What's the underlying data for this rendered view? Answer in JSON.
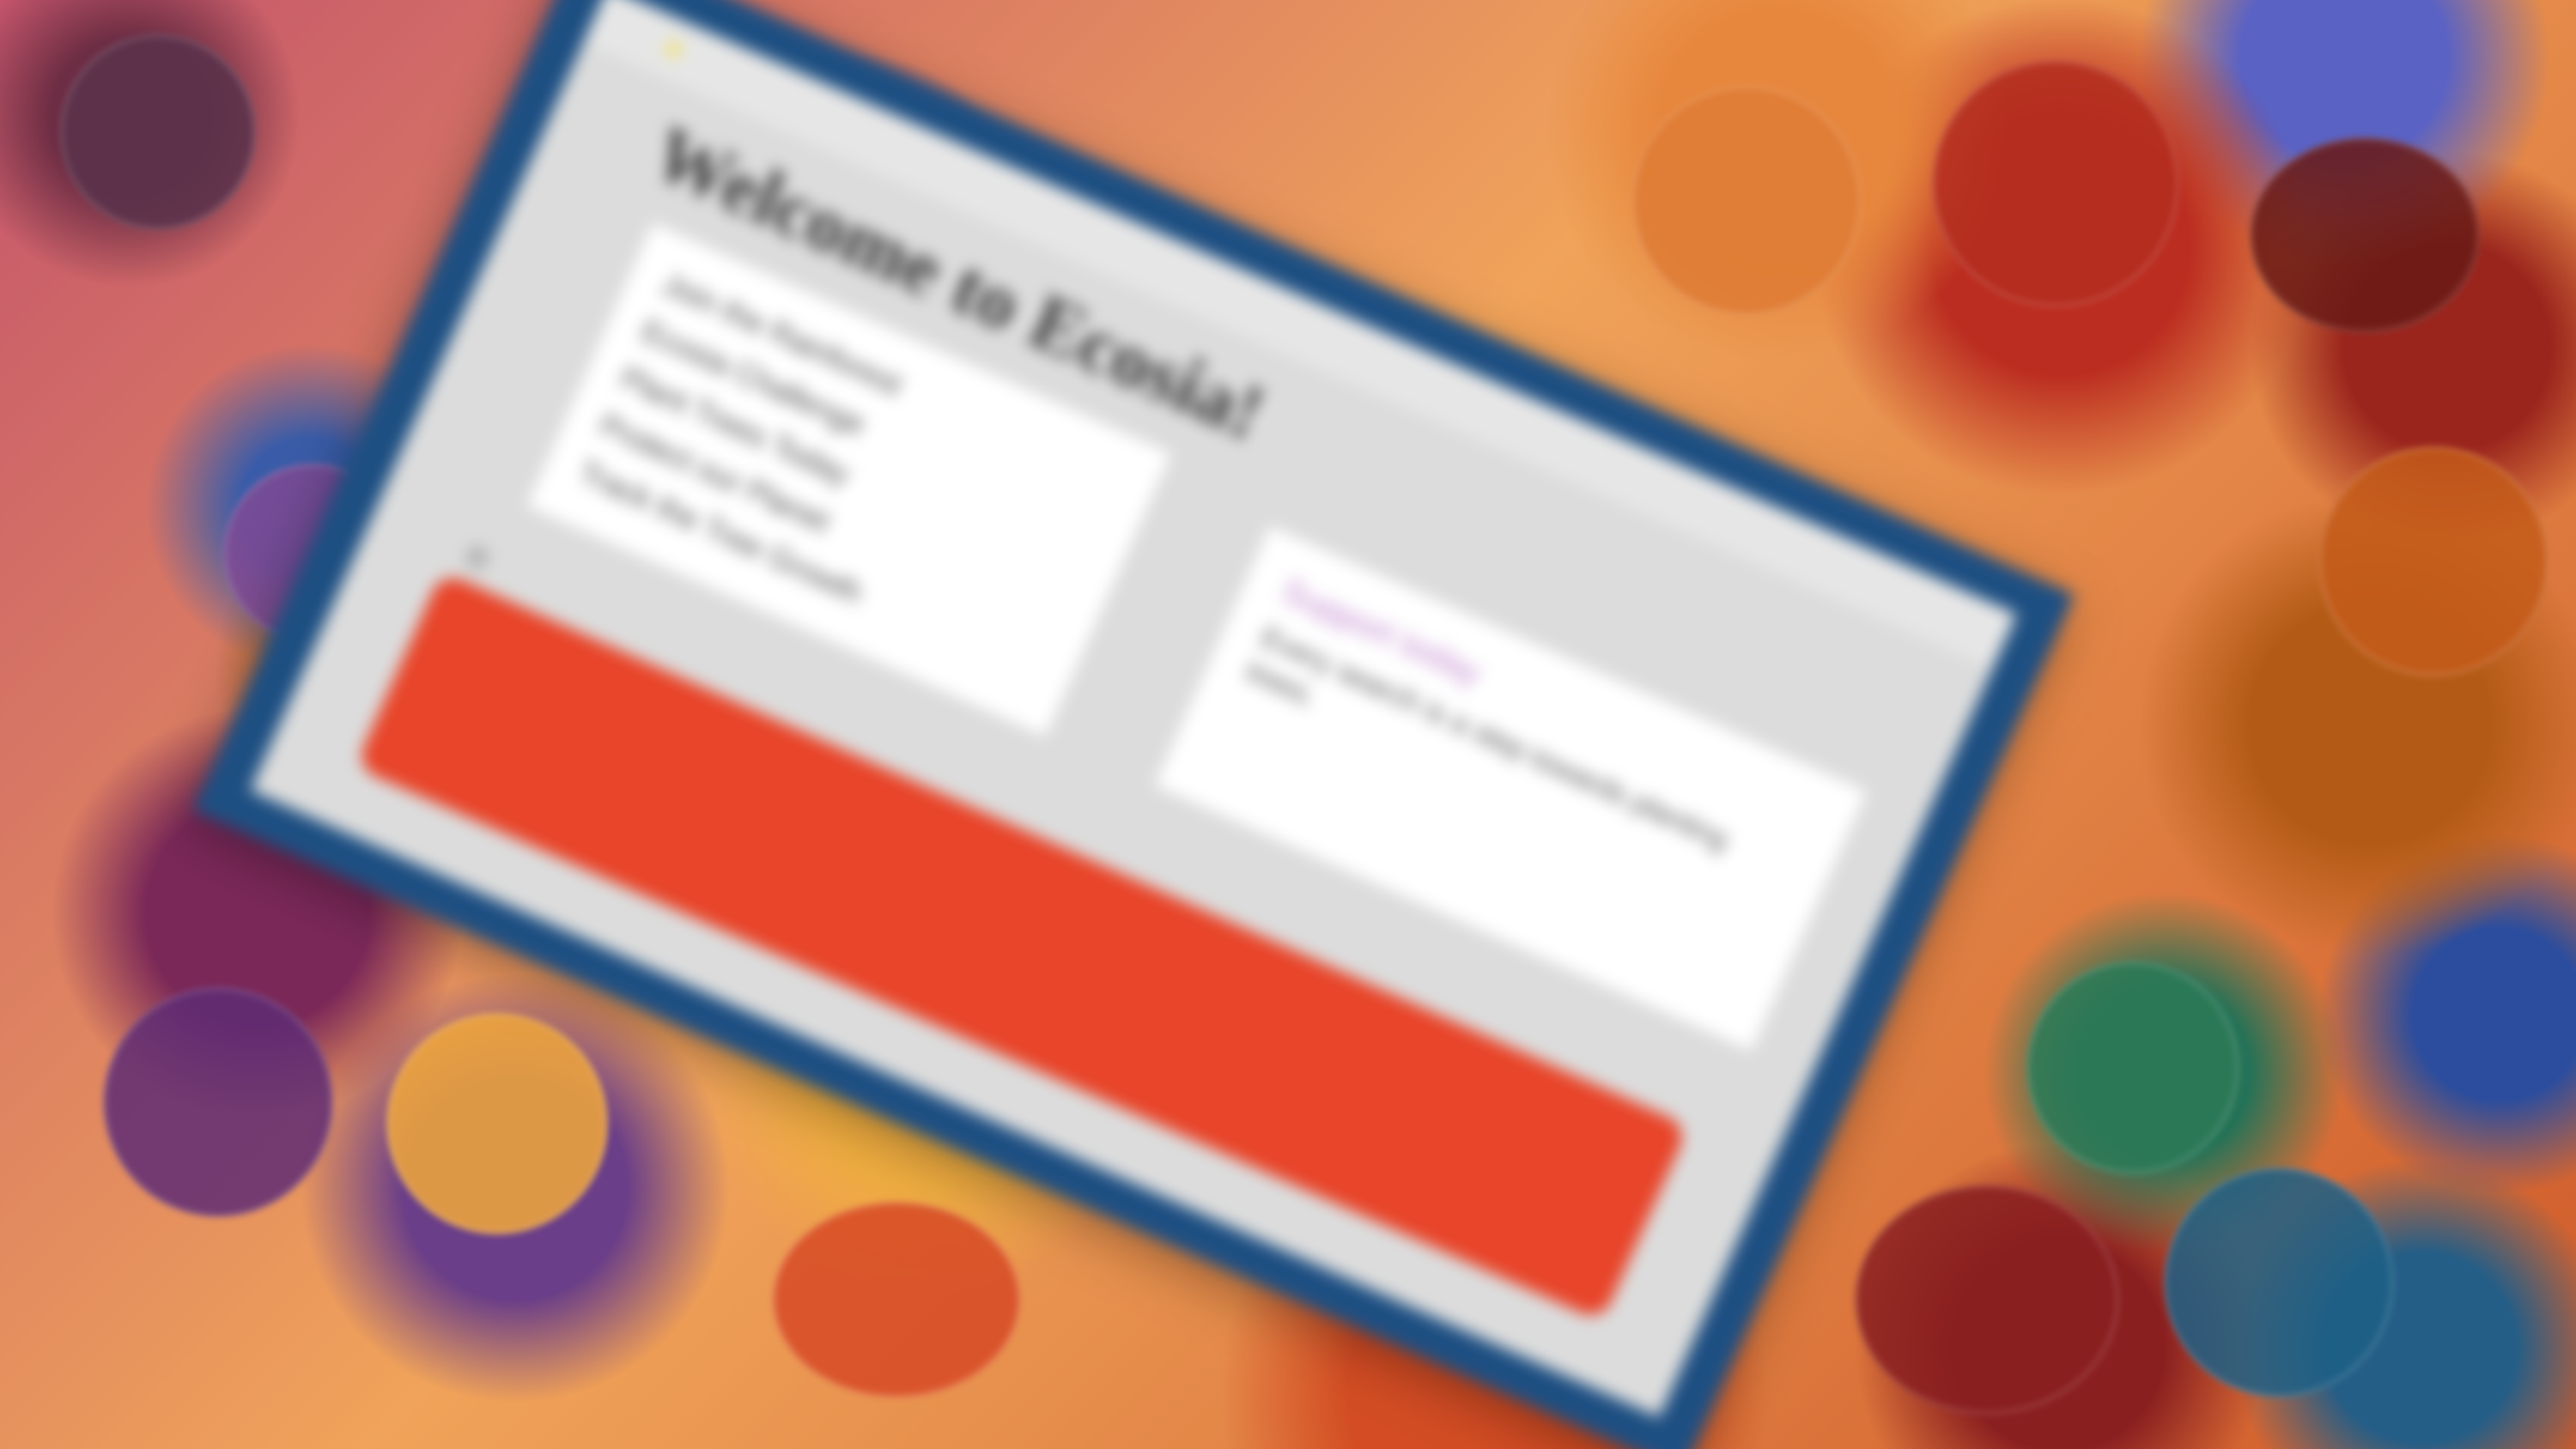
{
  "background": {
    "description_label": "",
    "accent_colors": [
      "#6d2d44",
      "#3a5ca8",
      "#7a2858",
      "#6a3e88",
      "#1f3f8c",
      "#553070",
      "#a76a2a",
      "#f0ad40",
      "#d34c23",
      "#e7873d",
      "#bb2d20",
      "#5a62c4",
      "#9a251d",
      "#b35b16",
      "#247257",
      "#2c4d9d",
      "#8a1f20",
      "#245e87"
    ]
  },
  "window": {
    "title": "Welcome to Ecosia!",
    "frame_color": "#1e4f82",
    "body_color": "#dcdcdc"
  },
  "cards": {
    "left": {
      "lines": [
        "Join the Rainforest",
        "Ecosia Challenge",
        "Plant Trees Today",
        "Protect our Planet",
        "Track the Tree Growth"
      ]
    },
    "right": {
      "heading": "Support today",
      "description": "Every search is a step towards planting trees."
    }
  },
  "banner": {
    "label": "",
    "color": "#e8452a"
  },
  "icons": {
    "settings": "gear-icon"
  },
  "corner_text_top": "",
  "corner_text_mid": ""
}
